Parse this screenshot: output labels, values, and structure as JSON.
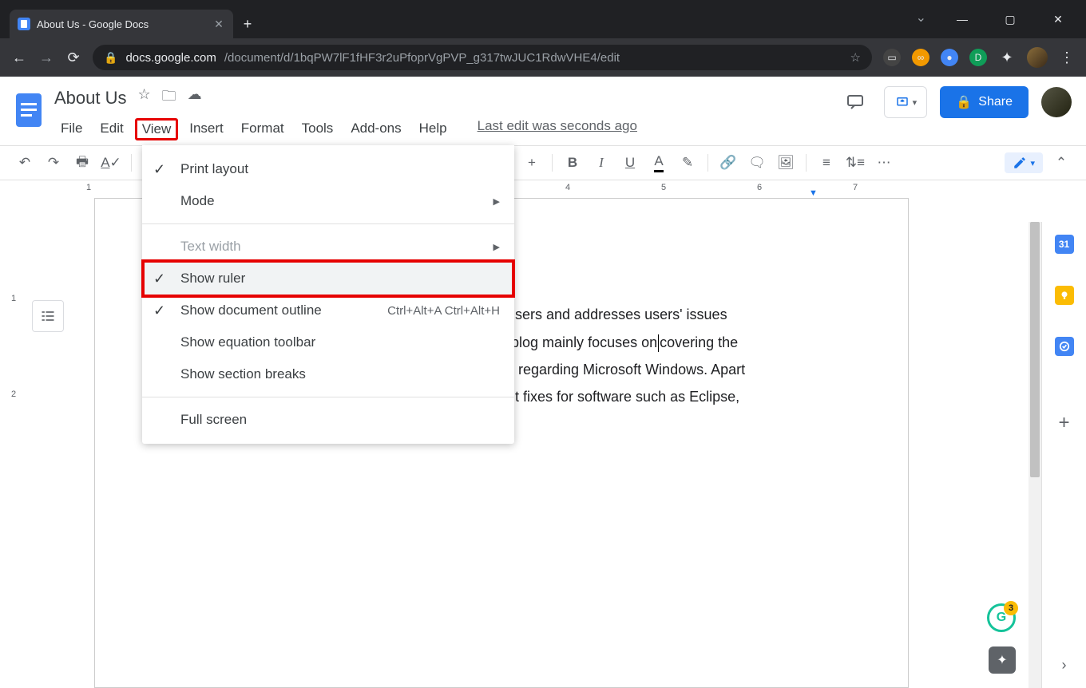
{
  "browser": {
    "tab_title": "About Us - Google Docs",
    "url_host": "docs.google.com",
    "url_path": "/document/d/1bqPW7lF1fHF3r2uPfoprVgPVP_g317twJUC1RdwVHE4/edit"
  },
  "docs": {
    "title": "About Us",
    "share_label": "Share",
    "last_edit": "Last edit was seconds ago",
    "menubar": [
      "File",
      "Edit",
      "View",
      "Insert",
      "Format",
      "Tools",
      "Add-ons",
      "Help"
    ],
    "active_menu_index": 2
  },
  "toolbar": {
    "font_plus": "+",
    "more": "⋯"
  },
  "ruler": {
    "h": [
      "1",
      "4",
      "5",
      "6",
      "7"
    ],
    "v": [
      "1",
      "2"
    ]
  },
  "view_menu": {
    "items": [
      {
        "label": "Print layout",
        "checked": true
      },
      {
        "label": "Mode",
        "submenu": true
      },
      {
        "sep": true
      },
      {
        "label": "Text width",
        "disabled": true,
        "submenu": true
      },
      {
        "label": "Show ruler",
        "checked": true,
        "hover": true,
        "highlight": true
      },
      {
        "label": "Show document outline",
        "checked": true,
        "shortcut": "Ctrl+Alt+A Ctrl+Alt+H"
      },
      {
        "label": "Show equation toolbar"
      },
      {
        "label": "Show section breaks"
      },
      {
        "sep": true
      },
      {
        "label": "Full screen"
      }
    ]
  },
  "document_body": {
    "line1_visible": "users and addresses users' issues",
    "line2a_visible": " blog mainly focuses on",
    "line2b_visible": "covering the",
    "line3_visible": "s regarding Microsoft Windows. Apart",
    "line4_visible": "nt fixes for software such as Eclipse,"
  },
  "sidepanel": {
    "calendar": "31",
    "keep": "",
    "tasks": "",
    "plus": "+"
  },
  "grammarly_count": "3"
}
